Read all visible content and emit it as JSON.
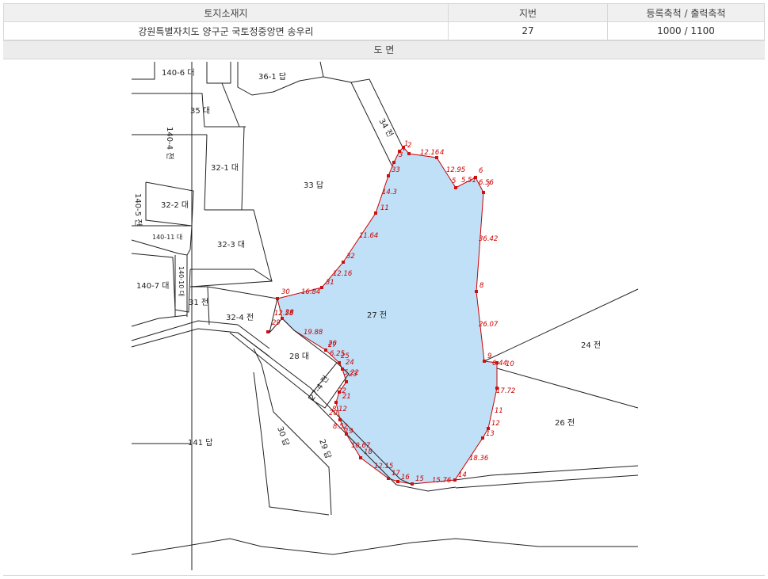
{
  "info": {
    "headers": [
      "토지소재지",
      "지번",
      "등록축척 / 출력축척"
    ],
    "row": [
      "강원특별자치도 양구군 국토정중앙면 송우리",
      "27",
      "1000 / 1100"
    ]
  },
  "section_title": "도 면",
  "colors": {
    "parcel_fill": "#bfe0f7",
    "boundary": "#cc0000",
    "line": "#222222"
  },
  "parcels": [
    {
      "id": "p140-6",
      "label": "140-6 대"
    },
    {
      "id": "p36-1",
      "label": "36-1 답"
    },
    {
      "id": "p35",
      "label": "35 대"
    },
    {
      "id": "p140-4",
      "label": "140-4 전"
    },
    {
      "id": "p34",
      "label": "34 전"
    },
    {
      "id": "p33",
      "label": "33 답"
    },
    {
      "id": "p32-1",
      "label": "32-1 대"
    },
    {
      "id": "p32-2",
      "label": "32-2 대"
    },
    {
      "id": "p140-5",
      "label": "140-5 전"
    },
    {
      "id": "p140-11",
      "label": "140-11 대"
    },
    {
      "id": "p32-3",
      "label": "32-3 대"
    },
    {
      "id": "p140-7",
      "label": "140-7 대"
    },
    {
      "id": "p140-10",
      "label": "140-10 대"
    },
    {
      "id": "p31",
      "label": "31 전"
    },
    {
      "id": "p32-4",
      "label": "32-4 전"
    },
    {
      "id": "p27",
      "label": "27 전"
    },
    {
      "id": "p28",
      "label": "28 대"
    },
    {
      "id": "p27-4",
      "label": "27-4 전"
    },
    {
      "id": "p24",
      "label": "24 전"
    },
    {
      "id": "p26",
      "label": "26 전"
    },
    {
      "id": "p141",
      "label": "141 답"
    },
    {
      "id": "p30",
      "label": "30 답"
    },
    {
      "id": "p29",
      "label": "29 답"
    }
  ],
  "boundary_points": [
    "1",
    "2",
    "3",
    "4",
    "5",
    "6",
    "7",
    "8",
    "9",
    "10",
    "11",
    "12",
    "13",
    "14",
    "15",
    "16",
    "17",
    "18",
    "19",
    "20",
    "21",
    "22",
    "23",
    "24",
    "25",
    "26",
    "27",
    "28",
    "29",
    "30",
    "31",
    "32",
    "33"
  ],
  "edge_lengths": [
    "12.16",
    "12.95",
    "5.51",
    "6.56",
    "36.42",
    "26.07",
    "6.44",
    "17.72",
    "18.36",
    "15.76",
    "12.15",
    "10.67",
    "8.52",
    "8.12",
    "5.22",
    "6.25",
    "19.88",
    "12.58",
    "16.84",
    "12.16",
    "11.64",
    "14.3",
    "11"
  ]
}
